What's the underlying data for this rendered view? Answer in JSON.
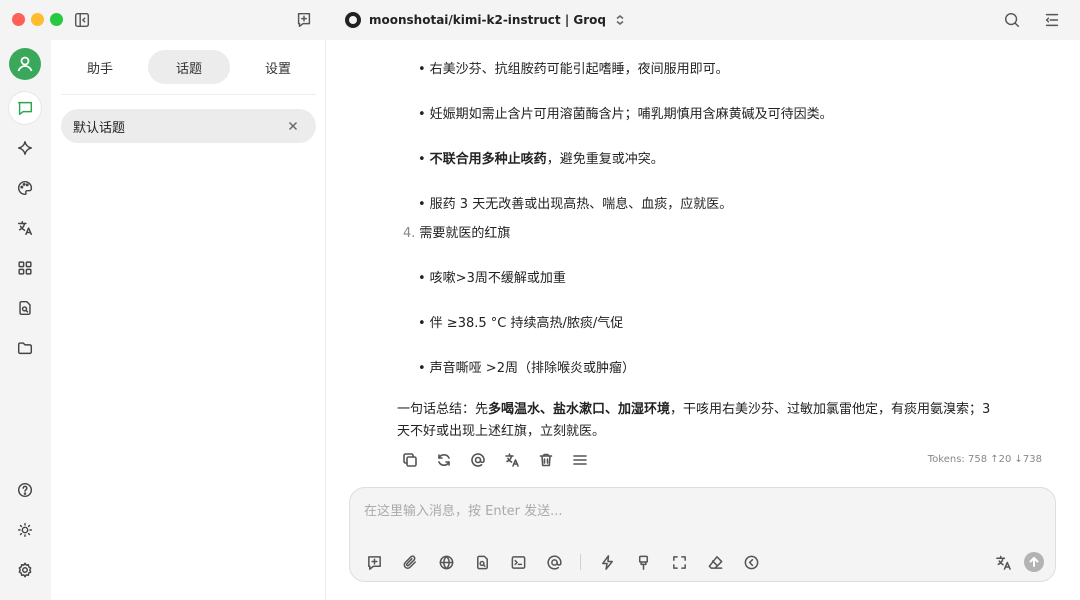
{
  "titlebar": {
    "model_label": "moonshotai/kimi-k2-instruct | Groq"
  },
  "sidebar": {
    "tabs": [
      {
        "label": "助手",
        "active": false
      },
      {
        "label": "话题",
        "active": true
      },
      {
        "label": "设置",
        "active": false
      }
    ],
    "topics": [
      {
        "label": "默认话题"
      }
    ]
  },
  "message": {
    "lines": {
      "l1": "右美沙芬、抗组胺药可能引起嗜睡，夜间服用即可。",
      "l2": "妊娠期如需止含片可用溶菌酶含片；哺乳期慎用含麻黄碱及可待因类。",
      "l3_bold": "不联合用多种止咳药",
      "l3_rest": "，避免重复或冲突。",
      "l4": "服药 3 天无改善或出现高热、喘息、血痰，应就医。",
      "s4_num": "4.",
      "s4_title": "需要就医的红旗",
      "r1": "咳嗽>3周不缓解或加重",
      "r2": "伴 ≥38.5 °C 持续高热/脓痰/气促",
      "r3": "声音嘶哑 >2周（排除喉炎或肿瘤）",
      "sum_a": "一句话总结：先",
      "sum_b": "多喝温水、盐水漱口、加湿环境",
      "sum_c": "，干咳用右美沙芬、过敏加氯雷他定，有痰用氨溴索；3",
      "sum_d": "天不好或出现上述红旗，立刻就医。"
    },
    "bullet": "•",
    "tokens": "Tokens: 758 ↑20 ↓738"
  },
  "composer": {
    "placeholder": "在这里输入消息，按 Enter 发送..."
  },
  "colors": {
    "accent": "#2ea44f",
    "avatar": "#3aa85a"
  }
}
